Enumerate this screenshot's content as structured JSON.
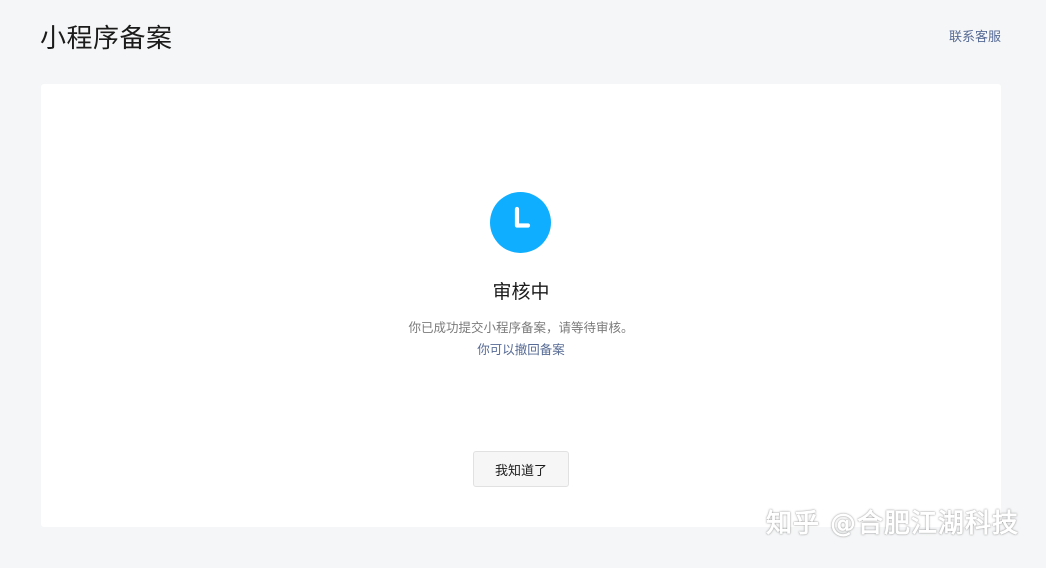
{
  "header": {
    "title": "小程序备案",
    "contact_label": "联系客服"
  },
  "status": {
    "icon": "clock-icon",
    "icon_color": "#10aeff",
    "title": "审核中",
    "description_line1": "你已成功提交小程序备案，请等待审核。",
    "description_line2": "你可以撤回备案"
  },
  "actions": {
    "ack_label": "我知道了"
  },
  "watermark": {
    "text": "知乎 @合肥江湖科技"
  },
  "colors": {
    "background": "#f5f6f7",
    "card": "#ffffff",
    "link": "#576b95",
    "accent": "#10aeff"
  }
}
